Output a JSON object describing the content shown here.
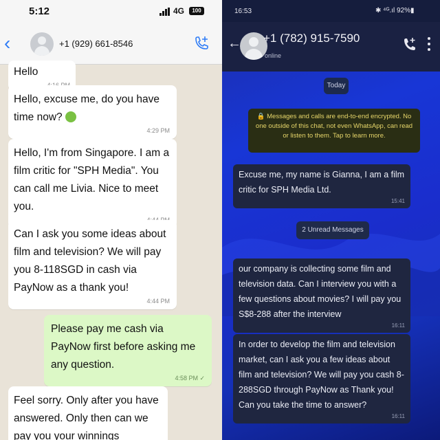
{
  "left": {
    "status": {
      "time": "5:12",
      "network": "4G",
      "battery": "100"
    },
    "header": {
      "contact": "+1 (929) 661-8546"
    },
    "messages": [
      {
        "text": "Hello",
        "time": "4:16 PM",
        "direction": "incoming"
      },
      {
        "text": "Hello, excuse me, do you have time now?",
        "time": "4:29 PM",
        "direction": "incoming"
      },
      {
        "text": "Hello, I'm from Singapore. I am a film critic for \"SPH Media\". You can call me Livia. Nice to meet you.",
        "time": "4:44 PM",
        "direction": "incoming"
      },
      {
        "text": "Can I ask you some ideas about film and television? We will pay you 8-118SGD in cash via PayNow as a thank you!",
        "time": "4:44 PM",
        "direction": "incoming"
      },
      {
        "text": "Please pay me cash via PayNow first before asking me any question.",
        "time": "4:58 PM ✓",
        "direction": "outgoing"
      },
      {
        "text": "Feel sorry. Only after you have answered. Only then can we pay you your winnings",
        "time": "",
        "direction": "incoming"
      }
    ]
  },
  "right": {
    "status": {
      "time": "16:53",
      "icons": "✱ ⁴ᴳ.ıl 92%▮"
    },
    "header": {
      "contact": "+1 (782) 915-7590",
      "status": "online"
    },
    "today_label": "Today",
    "encryption_notice": "🔒 Messages and calls are end-to-end encrypted. No one outside of this chat, not even WhatsApp, can read or listen to them. Tap to learn more.",
    "unread_label": "2 Unread Messages",
    "messages": [
      {
        "text": "Excuse me, my name is Gianna, I am a film critic for SPH Media Ltd.",
        "time": "15:41"
      },
      {
        "text": "our company is collecting some film and television data. Can I interview you with a few questions about movies? I will pay you S$8-288 after the interview",
        "time": "16:11"
      },
      {
        "text": "In order to develop the film and television market, can I ask you a few ideas about film and television? We will pay you cash 8-288SGD through PayNow as Thank you! Can you take the time to answer?",
        "time": "16:11"
      }
    ]
  },
  "colors": {
    "ios_outgoing": "#dcf8c6",
    "ios_incoming": "#ffffff",
    "ios_accent": "#2f7cf6",
    "android_bubble": "#1f2640",
    "android_background": "#1a2dcc"
  }
}
